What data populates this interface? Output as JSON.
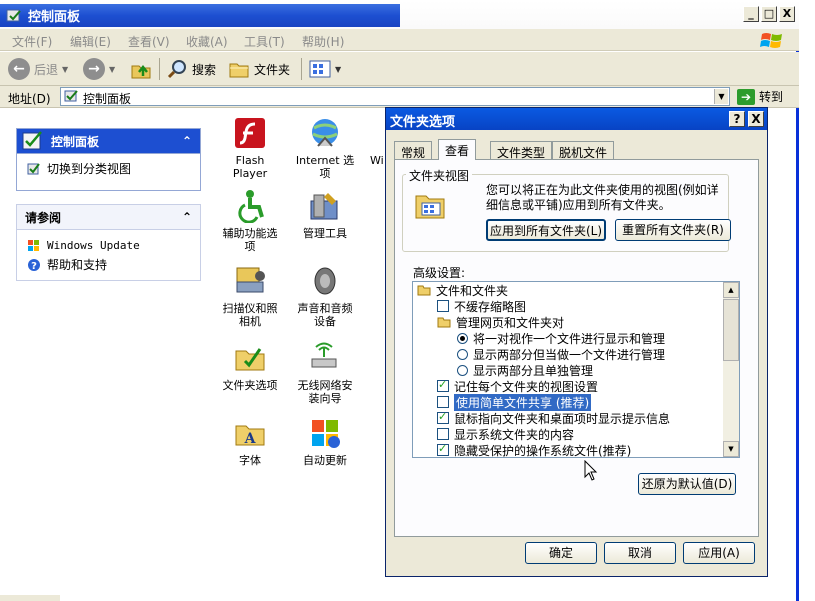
{
  "window": {
    "title": "控制面板",
    "min_label": "_",
    "max_label": "□",
    "close_label": "X"
  },
  "menu": [
    "文件(F)",
    "编辑(E)",
    "查看(V)",
    "收藏(A)",
    "工具(T)",
    "帮助(H)"
  ],
  "toolbar": {
    "back_label": "后退",
    "search_label": "搜索",
    "folders_label": "文件夹"
  },
  "address": {
    "label": "地址(D)",
    "value": "控制面板",
    "go_label": "转到"
  },
  "sidebar": {
    "panel1": {
      "title": "控制面板",
      "item": "切换到分类视图"
    },
    "panel2": {
      "title": "请参阅",
      "items": [
        "Windows Update",
        "帮助和支持"
      ]
    }
  },
  "applets": [
    {
      "label": "Flash\nPlayer",
      "icon": "flash-icon"
    },
    {
      "label": "Internet 选\n项",
      "icon": "internet-options-icon"
    },
    {
      "label": "Wi",
      "icon": "windows-firewall-icon"
    },
    {
      "label": "辅助功能选\n项",
      "icon": "accessibility-icon"
    },
    {
      "label": "管理工具",
      "icon": "admin-tools-icon"
    },
    {
      "label": "扫描仪和照\n相机",
      "icon": "scanner-icon"
    },
    {
      "label": "声音和音频\n设备",
      "icon": "sound-icon"
    },
    {
      "label": "文件夹选项",
      "icon": "folder-options-icon"
    },
    {
      "label": "无线网络安\n装向导",
      "icon": "wireless-icon"
    },
    {
      "label": "字体",
      "icon": "fonts-icon"
    },
    {
      "label": "自动更新",
      "icon": "auto-update-icon"
    }
  ],
  "dialog": {
    "title": "文件夹选项",
    "help_label": "?",
    "close_label": "X",
    "tabs": [
      "常规",
      "查看",
      "文件类型",
      "脱机文件"
    ],
    "active_tab": "查看",
    "views_group": {
      "label": "文件夹视图",
      "description": "您可以将正在为此文件夹使用的视图(例如详细信息或平铺)应用到所有文件夹。",
      "apply_all": "应用到所有文件夹(L)",
      "reset_all": "重置所有文件夹(R)"
    },
    "advanced_label": "高级设置:",
    "tree": [
      {
        "kind": "folder",
        "label": "文件和文件夹",
        "indent": 0
      },
      {
        "kind": "check",
        "checked": false,
        "label": "不缓存缩略图",
        "indent": 1
      },
      {
        "kind": "folder",
        "label": "管理网页和文件夹对",
        "indent": 1
      },
      {
        "kind": "radio",
        "checked": true,
        "label": "将一对视作一个文件进行显示和管理",
        "indent": 2
      },
      {
        "kind": "radio",
        "checked": false,
        "label": "显示两部分但当做一个文件进行管理",
        "indent": 2
      },
      {
        "kind": "radio",
        "checked": false,
        "label": "显示两部分且单独管理",
        "indent": 2
      },
      {
        "kind": "check",
        "checked": true,
        "label": "记住每个文件夹的视图设置",
        "indent": 1
      },
      {
        "kind": "check",
        "checked": false,
        "label": "使用简单文件共享 (推荐)",
        "indent": 1,
        "selected": true
      },
      {
        "kind": "check",
        "checked": true,
        "label": "鼠标指向文件夹和桌面项时显示提示信息",
        "indent": 1
      },
      {
        "kind": "check",
        "checked": false,
        "label": "显示系统文件夹的内容",
        "indent": 1
      },
      {
        "kind": "check",
        "checked": true,
        "label": "隐藏受保护的操作系统文件(推荐)",
        "indent": 1
      }
    ],
    "restore_defaults": "还原为默认值(D)",
    "ok": "确定",
    "cancel": "取消",
    "apply": "应用(A)"
  },
  "colors": {
    "title_blue": "#1d4fd1",
    "dialog_face": "#ece9d8",
    "selection": "#316ac5"
  }
}
